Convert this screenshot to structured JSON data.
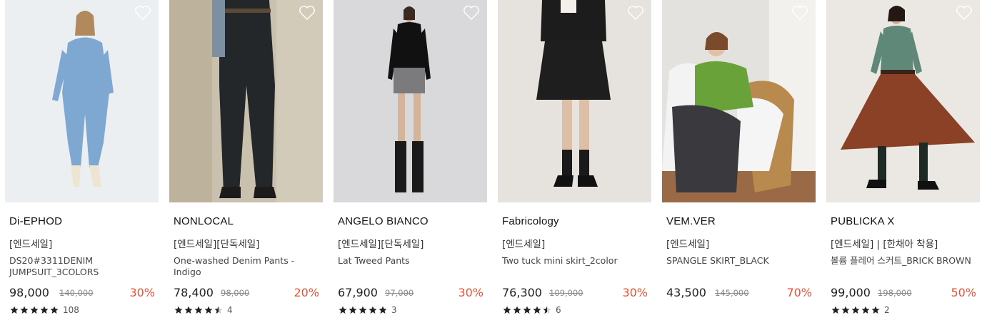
{
  "products": [
    {
      "brand": "Di-EPHOD",
      "tag": "[엔드세일]",
      "name": "DS20#3311DENIM JUMPSUIT_3COLORS",
      "price": "98,000",
      "original_price": "140,000",
      "discount": "30%",
      "rating": 5,
      "review_count": "108",
      "image": "model-denim-jumpsuit",
      "bg_color": "#eceff1"
    },
    {
      "brand": "NONLOCAL",
      "tag": "[엔드세일][단독세일]",
      "name": "One-washed Denim Pants - Indigo",
      "price": "78,400",
      "original_price": "98,000",
      "discount": "20%",
      "rating": 4.5,
      "review_count": "4",
      "image": "model-dark-denim-pants",
      "bg_color": "#c9c0ae"
    },
    {
      "brand": "ANGELO BIANCO",
      "tag": "[엔드세일][단독세일]",
      "name": "Lat Tweed Pants",
      "price": "67,900",
      "original_price": "97,000",
      "discount": "30%",
      "rating": 5,
      "review_count": "3",
      "image": "model-tweed-mini",
      "bg_color": "#d9d9dc"
    },
    {
      "brand": "Fabricology",
      "tag": "[엔드세일]",
      "name": "Two tuck mini skirt_2color",
      "price": "76,300",
      "original_price": "109,000",
      "discount": "30%",
      "rating": 4.5,
      "review_count": "6",
      "image": "model-black-mini-skirt",
      "bg_color": "#e6e2dd"
    },
    {
      "brand": "VEM.VER",
      "tag": "[엔드세일]",
      "name": "SPANGLE SKIRT_BLACK",
      "price": "43,500",
      "original_price": "145,000",
      "discount": "70%",
      "rating": null,
      "review_count": "",
      "image": "model-green-sweater-chair",
      "bg_color": "#e4e2de"
    },
    {
      "brand": "PUBLICKA X",
      "tag": "[엔드세일] | [한채아 착용]",
      "name": "볼륨 플레어 스커트_BRICK BROWN",
      "price": "99,000",
      "original_price": "198,000",
      "discount": "50%",
      "rating": 5,
      "review_count": "2",
      "image": "model-brick-flare-skirt",
      "bg_color": "#ebe8e3"
    }
  ],
  "colors": {
    "discount": "#ef4e2e",
    "star": "#222222"
  },
  "icons": {
    "wishlist": "heart-outline-icon",
    "rating": "star-icon"
  }
}
